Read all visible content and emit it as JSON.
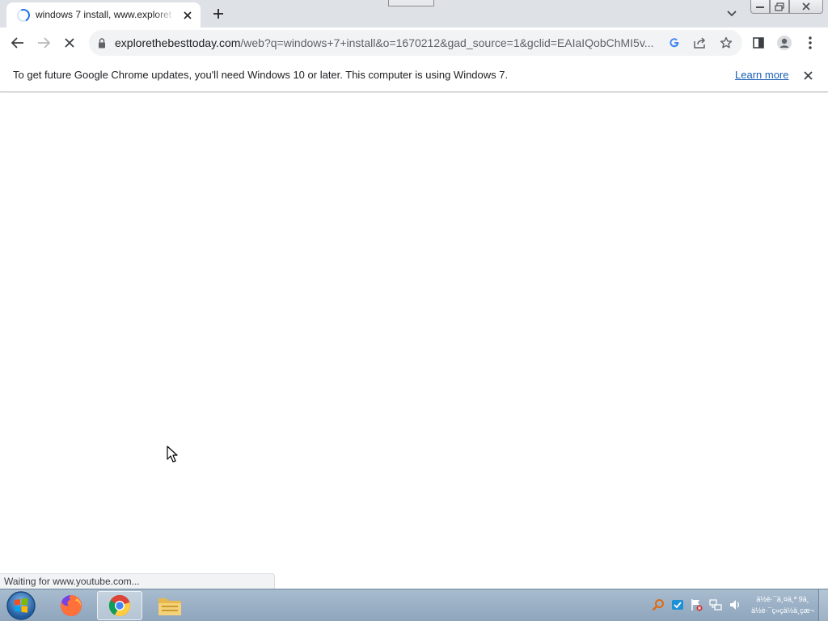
{
  "tab": {
    "title": "windows 7 install, www.exploret",
    "loading": true
  },
  "toolbar": {
    "url_host": "explorethebesttoday.com",
    "url_path": "/web?q=windows+7+install&o=1670212&gad_source=1&gclid=EAIaIQobChMI5v..."
  },
  "infobar": {
    "message": "To get future Google Chrome updates, you'll need Windows 10 or later. This computer is using Windows 7.",
    "link": "Learn more"
  },
  "status": {
    "text": "Waiting for www.youtube.com..."
  },
  "taskbar": {
    "apps": [
      "firefox",
      "chrome",
      "file-explorer"
    ],
    "active_app": "chrome",
    "clock_line1": "ä½è·¯ä¸¤ä¸ª 9ä¸",
    "clock_line2": "ä½è·¯ç»­çä½ä¸çæ¬"
  },
  "colors": {
    "tabstrip": "#dee1e6",
    "omnibox": "#f1f3f4",
    "accent": "#1a73e8",
    "link": "#1a5fb4",
    "taskbar": "#9fb3c8"
  }
}
